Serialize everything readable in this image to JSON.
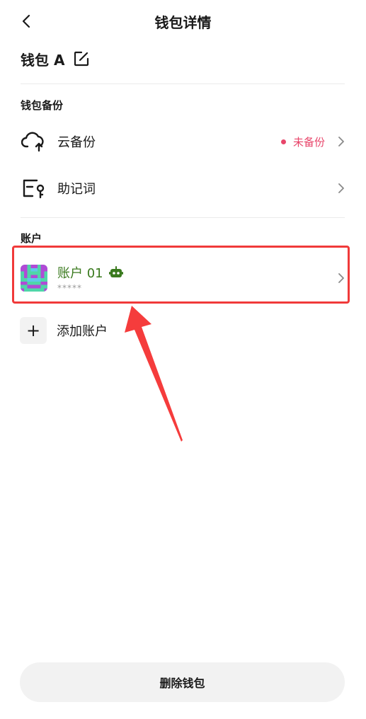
{
  "header": {
    "title": "钱包详情"
  },
  "wallet": {
    "name": "钱包 A"
  },
  "backup_section": {
    "label": "钱包备份",
    "items": [
      {
        "label": "云备份",
        "status": "未备份",
        "icon": "cloud-upload-icon"
      },
      {
        "label": "助记词",
        "icon": "mnemonic-key-icon"
      }
    ]
  },
  "accounts_section": {
    "label": "账户",
    "accounts": [
      {
        "name": "账户 01",
        "address": "*****",
        "badge_icon": "robot-icon"
      }
    ],
    "add_label": "添加账户"
  },
  "footer": {
    "delete_label": "删除钱包"
  },
  "colors": {
    "status_red": "#e8456a",
    "account_green": "#3a7a1e",
    "highlight_red": "#f03a3a"
  }
}
